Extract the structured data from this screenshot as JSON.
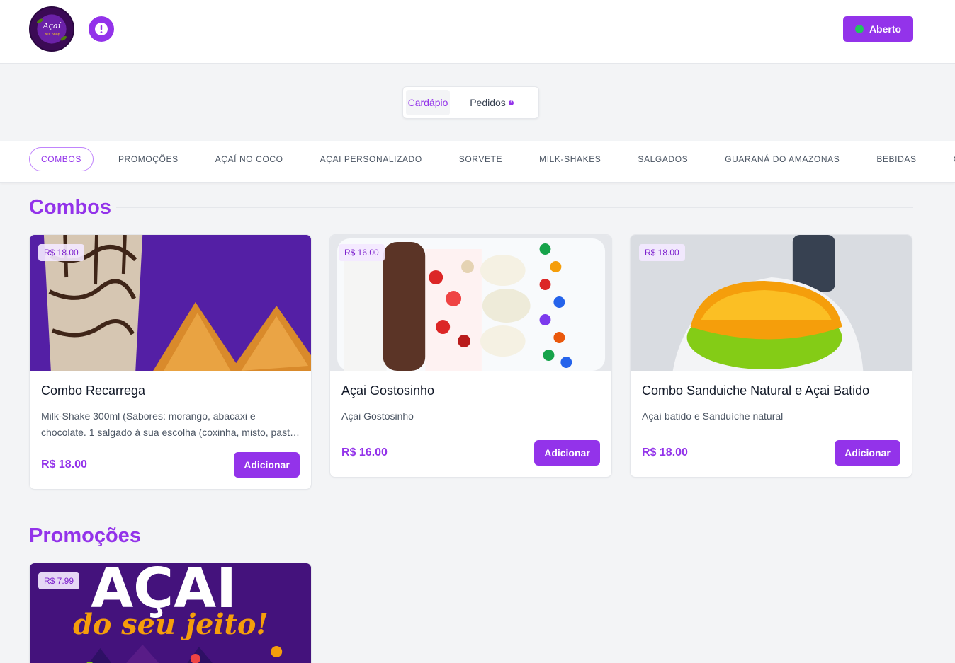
{
  "header": {
    "logo_text": "Açaí",
    "logo_subtext": "Mix Shop",
    "status_label": "Aberto",
    "colors": {
      "accent": "#9333ea",
      "open": "#22c55e"
    }
  },
  "tabs": [
    {
      "label": "Cardápio",
      "active": true
    },
    {
      "label": "Pedidos",
      "active": false,
      "badge": "!"
    }
  ],
  "categories": [
    {
      "label": "COMBOS",
      "active": true
    },
    {
      "label": "PROMOÇÕES"
    },
    {
      "label": "AÇAÍ NO COCO"
    },
    {
      "label": "AÇAI PERSONALIZADO"
    },
    {
      "label": "SORVETE"
    },
    {
      "label": "MILK-SHAKES"
    },
    {
      "label": "SALGADOS"
    },
    {
      "label": "GUARANÁ DO AMAZONAS"
    },
    {
      "label": "BEBIDAS"
    },
    {
      "label": "GELO"
    }
  ],
  "sections": {
    "combos": {
      "title": "Combos",
      "products": [
        {
          "badge": "R$ 18.00",
          "name": "Combo Recarrega",
          "description": "Milk-Shake 300ml (Sabores: morango, abacaxi e chocolate. 1 salgado à sua escolha (coxinha, misto, pastel de forno e...",
          "price": "R$ 18.00",
          "button": "Adicionar"
        },
        {
          "badge": "R$ 16.00",
          "name": "Açai Gostosinho",
          "description": "Açai Gostosinho",
          "price": "R$ 16.00",
          "button": "Adicionar"
        },
        {
          "badge": "R$ 18.00",
          "name": "Combo Sanduiche Natural e Açai Batido",
          "description": "Açaí batido e Sanduíche natural",
          "price": "R$ 18.00",
          "button": "Adicionar"
        }
      ]
    },
    "promocoes": {
      "title": "Promoções",
      "products": [
        {
          "badge": "R$ 7.99",
          "image_text_top": "AÇAI",
          "image_text_bottom": "do seu jeito!"
        }
      ]
    }
  }
}
